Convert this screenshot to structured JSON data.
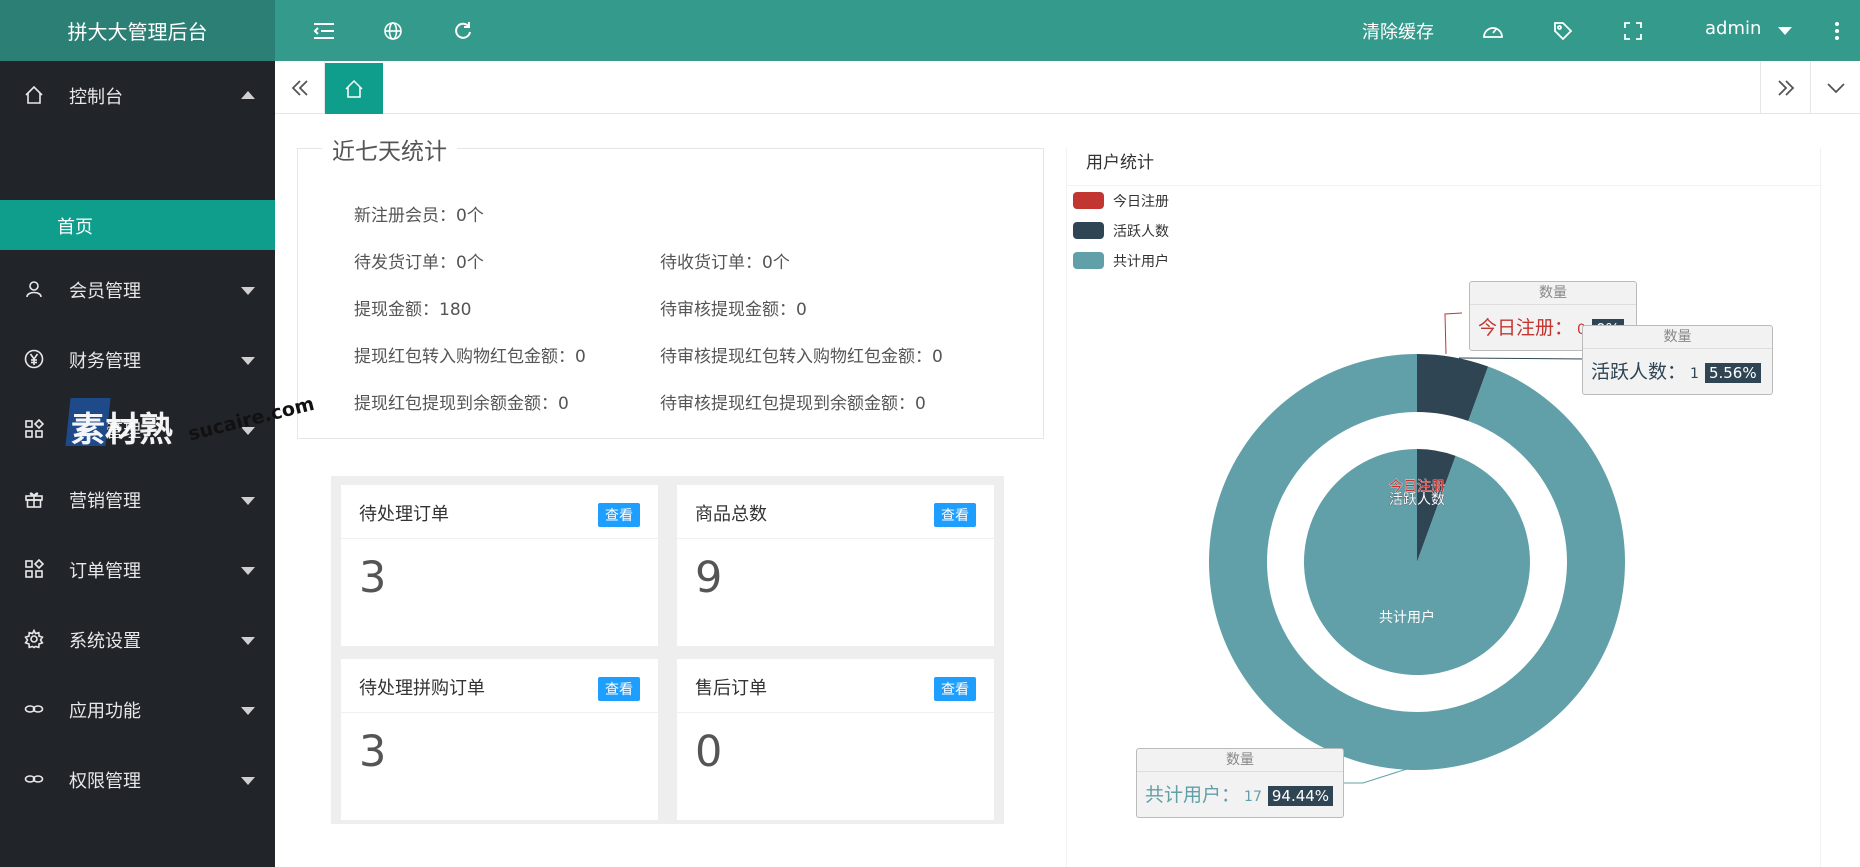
{
  "app": {
    "title": "拼大大管理后台"
  },
  "topbar": {
    "clear_cache": "清除缓存",
    "user": "admin",
    "icons": [
      "menu-fold-icon",
      "globe-icon",
      "refresh-icon",
      "dashboard-icon",
      "tag-icon",
      "fullscreen-icon",
      "more-vertical-icon"
    ]
  },
  "sidebar": {
    "items": [
      {
        "label": "控制台",
        "icon": "home-icon",
        "expanded": true
      },
      {
        "label": "会员管理",
        "icon": "user-icon"
      },
      {
        "label": "财务管理",
        "icon": "yen-icon"
      },
      {
        "label": "商品管理",
        "icon": "grid-icon"
      },
      {
        "label": "营销管理",
        "icon": "gift-icon"
      },
      {
        "label": "订单管理",
        "icon": "grid-icon"
      },
      {
        "label": "系统设置",
        "icon": "gear-icon"
      },
      {
        "label": "应用功能",
        "icon": "link-icon"
      },
      {
        "label": "权限管理",
        "icon": "link-icon"
      }
    ],
    "sub_item": "首页"
  },
  "tabs": {
    "home_icon": "home-icon"
  },
  "stats": {
    "title": "近七天统计",
    "new_members": "新注册会员：0个",
    "pending_ship": "待发货订单：0个",
    "pending_receive": "待收货订单：0个",
    "withdraw_amount": "提现金额：180",
    "pending_withdraw": "待审核提现金额：0",
    "redpack_to_cart": "提现红包转入购物红包金额：0",
    "pending_redpack_to_cart": "待审核提现红包转入购物红包金额：0",
    "redpack_to_balance": "提现红包提现到余额金额：0",
    "pending_redpack_to_balance": "待审核提现红包提现到余额金额：0"
  },
  "cards": [
    {
      "title": "待处理订单",
      "button": "查看",
      "value": "3"
    },
    {
      "title": "商品总数",
      "button": "查看",
      "value": "9"
    },
    {
      "title": "待处理拼购订单",
      "button": "查看",
      "value": "3"
    },
    {
      "title": "售后订单",
      "button": "查看",
      "value": "0"
    }
  ],
  "chart": {
    "panel_title": "用户统计"
  },
  "chart_data": {
    "type": "pie",
    "title": "用户统计",
    "series": [
      {
        "name": "今日注册",
        "value": 0,
        "percent": "0%",
        "color": "#c23531"
      },
      {
        "name": "活跃人数",
        "value": 1,
        "percent": "5.56%",
        "color": "#2f4554"
      },
      {
        "name": "共计用户",
        "value": 17,
        "percent": "94.44%",
        "color": "#61a0a8"
      }
    ],
    "legend_position": "top-left",
    "tooltip_header": "数量"
  },
  "watermark": {
    "text": "素材熟",
    "url": "sucaire.com"
  },
  "colors": {
    "accent": "#0f9e8c",
    "header": "#349a8b",
    "sidebar": "#212429"
  }
}
